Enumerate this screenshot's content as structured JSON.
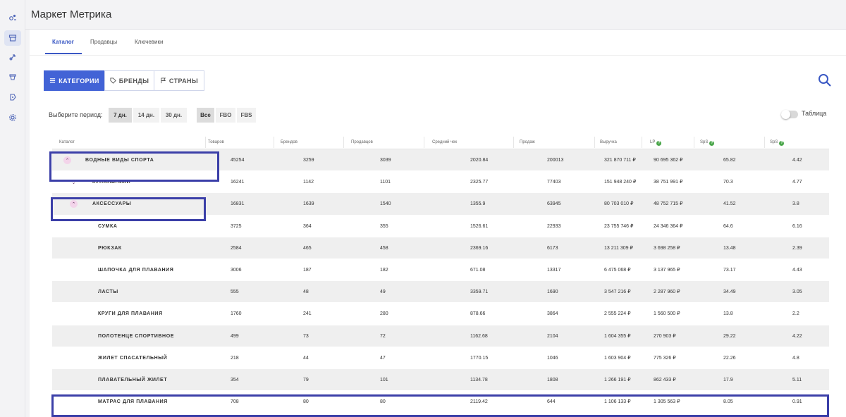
{
  "app": {
    "title": "Маркет Метрика"
  },
  "sidebar": {
    "items": [
      {
        "icon": "analytics-icon"
      },
      {
        "icon": "store-icon"
      },
      {
        "icon": "rocket-icon"
      },
      {
        "icon": "shopping-bag-icon"
      },
      {
        "icon": "tag-icon"
      },
      {
        "icon": "settings-icon"
      }
    ]
  },
  "tabs": {
    "catalog": "Каталог",
    "sellers": "Продавцы",
    "keywords": "Ключевики"
  },
  "segments": {
    "categories": "КАТЕГОРИИ",
    "brands": "БРЕНДЫ",
    "countries": "СТРАНЫ"
  },
  "period": {
    "label": "Выберите период:",
    "options": [
      "7 дн.",
      "14 дн.",
      "30 дн."
    ],
    "selected": "7 дн."
  },
  "fulfillment": {
    "options": [
      "Все",
      "FBO",
      "FBS"
    ],
    "selected": "Все"
  },
  "view_toggle": {
    "label": "Таблица"
  },
  "table": {
    "columns": {
      "catalog": "Каталог",
      "products": "Товаров",
      "brands": "Брендов",
      "sellers": "Продавцов",
      "avg_check": "Средний чек",
      "sales": "Продаж",
      "revenue": "Выручка",
      "lp": "LP",
      "sps1": "SpS",
      "sps2": "SpS"
    },
    "rows": [
      {
        "name": "ВОДНЫЕ ВИДЫ СПОРТА",
        "products": "45254",
        "brands": "3259",
        "sellers": "3039",
        "avg_check": "2020.84",
        "sales": "200013",
        "revenue": "321 870 711 ₽",
        "lp": "90 695 362 ₽",
        "sps1": "65.82",
        "sps2": "4.42"
      },
      {
        "name": "КУПАЛЬНИКИ",
        "products": "16241",
        "brands": "1142",
        "sellers": "1101",
        "avg_check": "2325.77",
        "sales": "77403",
        "revenue": "151 948 240 ₽",
        "lp": "38 751 991 ₽",
        "sps1": "70.3",
        "sps2": "4.77"
      },
      {
        "name": "АКСЕССУАРЫ",
        "products": "16831",
        "brands": "1639",
        "sellers": "1540",
        "avg_check": "1355.9",
        "sales": "63945",
        "revenue": "80 703 010 ₽",
        "lp": "48 752 715 ₽",
        "sps1": "41.52",
        "sps2": "3.8"
      },
      {
        "name": "СУМКА",
        "products": "3725",
        "brands": "364",
        "sellers": "355",
        "avg_check": "1526.61",
        "sales": "22933",
        "revenue": "23 755 746 ₽",
        "lp": "24 346 364 ₽",
        "sps1": "64.6",
        "sps2": "6.16"
      },
      {
        "name": "РЮКЗАК",
        "products": "2584",
        "brands": "465",
        "sellers": "458",
        "avg_check": "2369.16",
        "sales": "6173",
        "revenue": "13 211 309 ₽",
        "lp": "3 698 258 ₽",
        "sps1": "13.48",
        "sps2": "2.39"
      },
      {
        "name": "ШАПОЧКА ДЛЯ ПЛАВАНИЯ",
        "products": "3006",
        "brands": "187",
        "sellers": "182",
        "avg_check": "671.08",
        "sales": "13317",
        "revenue": "6 475 068 ₽",
        "lp": "3 137 965 ₽",
        "sps1": "73.17",
        "sps2": "4.43"
      },
      {
        "name": "ЛАСТЫ",
        "products": "555",
        "brands": "48",
        "sellers": "49",
        "avg_check": "3359.71",
        "sales": "1690",
        "revenue": "3 547 216 ₽",
        "lp": "2 287 960 ₽",
        "sps1": "34.49",
        "sps2": "3.05"
      },
      {
        "name": "КРУГИ ДЛЯ ПЛАВАНИЯ",
        "products": "1760",
        "brands": "241",
        "sellers": "280",
        "avg_check": "878.66",
        "sales": "3864",
        "revenue": "2 555 224 ₽",
        "lp": "1 560 500 ₽",
        "sps1": "13.8",
        "sps2": "2.2"
      },
      {
        "name": "ПОЛОТЕНЦЕ СПОРТИВНОЕ",
        "products": "499",
        "brands": "73",
        "sellers": "72",
        "avg_check": "1162.68",
        "sales": "2104",
        "revenue": "1 604 355 ₽",
        "lp": "270 903 ₽",
        "sps1": "29.22",
        "sps2": "4.22"
      },
      {
        "name": "ЖИЛЕТ СПАСАТЕЛЬНЫЙ",
        "products": "218",
        "brands": "44",
        "sellers": "47",
        "avg_check": "1770.15",
        "sales": "1046",
        "revenue": "1 603 904 ₽",
        "lp": "775 326 ₽",
        "sps1": "22.26",
        "sps2": "4.8"
      },
      {
        "name": "ПЛАВАТЕЛЬНЫЙ ЖИЛЕТ",
        "products": "354",
        "brands": "79",
        "sellers": "101",
        "avg_check": "1134.78",
        "sales": "1808",
        "revenue": "1 266 191 ₽",
        "lp": "862 433 ₽",
        "sps1": "17.9",
        "sps2": "5.11"
      },
      {
        "name": "МАТРАС ДЛЯ ПЛАВАНИЯ",
        "products": "708",
        "brands": "80",
        "sellers": "80",
        "avg_check": "2119.42",
        "sales": "644",
        "revenue": "1 106 133 ₽",
        "lp": "1 305 563 ₽",
        "sps1": "8.05",
        "sps2": "0.91"
      }
    ]
  },
  "colors": {
    "accent": "#4263d6",
    "highlight_box": "#3b3fa8",
    "row_shade": "#efefef",
    "help_icon": "#4aa64a"
  }
}
